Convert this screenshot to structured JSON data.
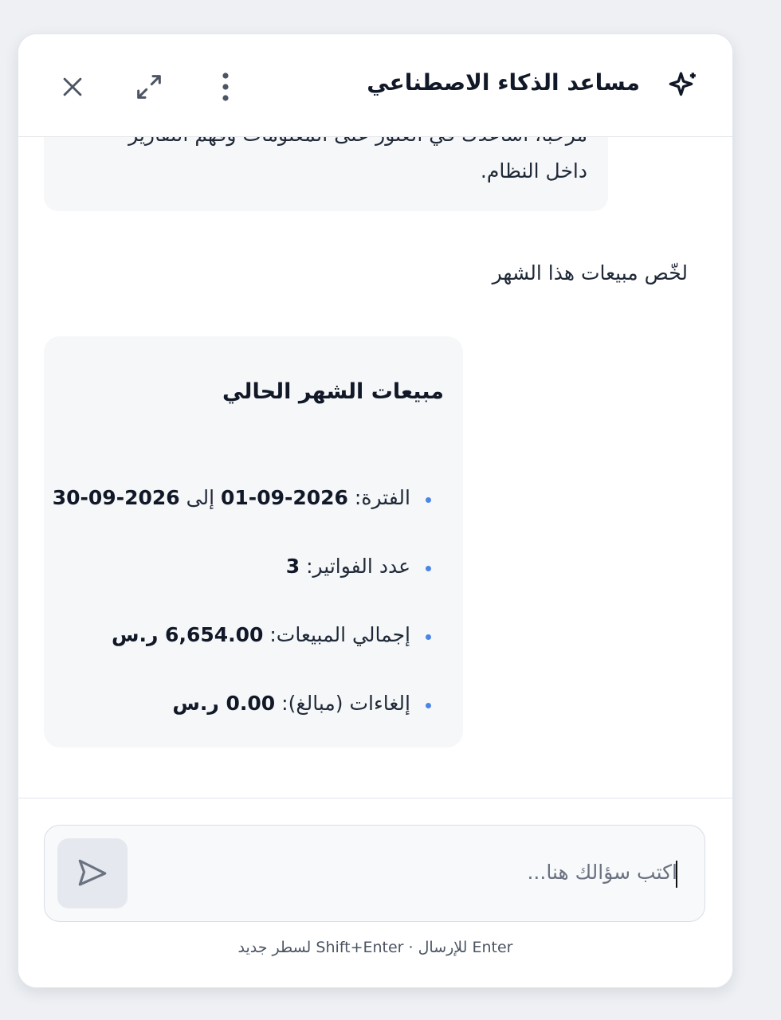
{
  "header": {
    "title": "مساعد الذكاء الاصطناعي",
    "icons": {
      "assistant": "sparkle-icon",
      "more": "more-vertical-icon",
      "expand": "expand-icon",
      "close": "close-icon"
    }
  },
  "messages": {
    "welcome": {
      "line1": "مرحباً، أساعدك في العثور على المعلومات وفهم التقارير",
      "line2": "داخل النظام."
    },
    "user_message": "لخّص مبيعات هذا الشهر",
    "answer": {
      "title": "مبيعات الشهر الحالي",
      "items": [
        {
          "label": "الفترة:",
          "value1": "2026-09-01",
          "mid": "إلى",
          "value2": "2026-09-30"
        },
        {
          "label": "عدد الفواتير:",
          "value": "3"
        },
        {
          "label": "إجمالي المبيعات:",
          "value": "6,654.00 ر.س"
        },
        {
          "label": "إلغاءات (مبالغ):",
          "value": "0.00 ر.س"
        }
      ]
    }
  },
  "composer": {
    "placeholder": "اكتب سؤالك هنا...",
    "send_icon": "send-icon",
    "hint": "Enter للإرسال · Shift+Enter لسطر جديد"
  },
  "colors": {
    "bullet": "#4a86e8",
    "bubble": "#f6f7f9",
    "title": "#111827"
  }
}
